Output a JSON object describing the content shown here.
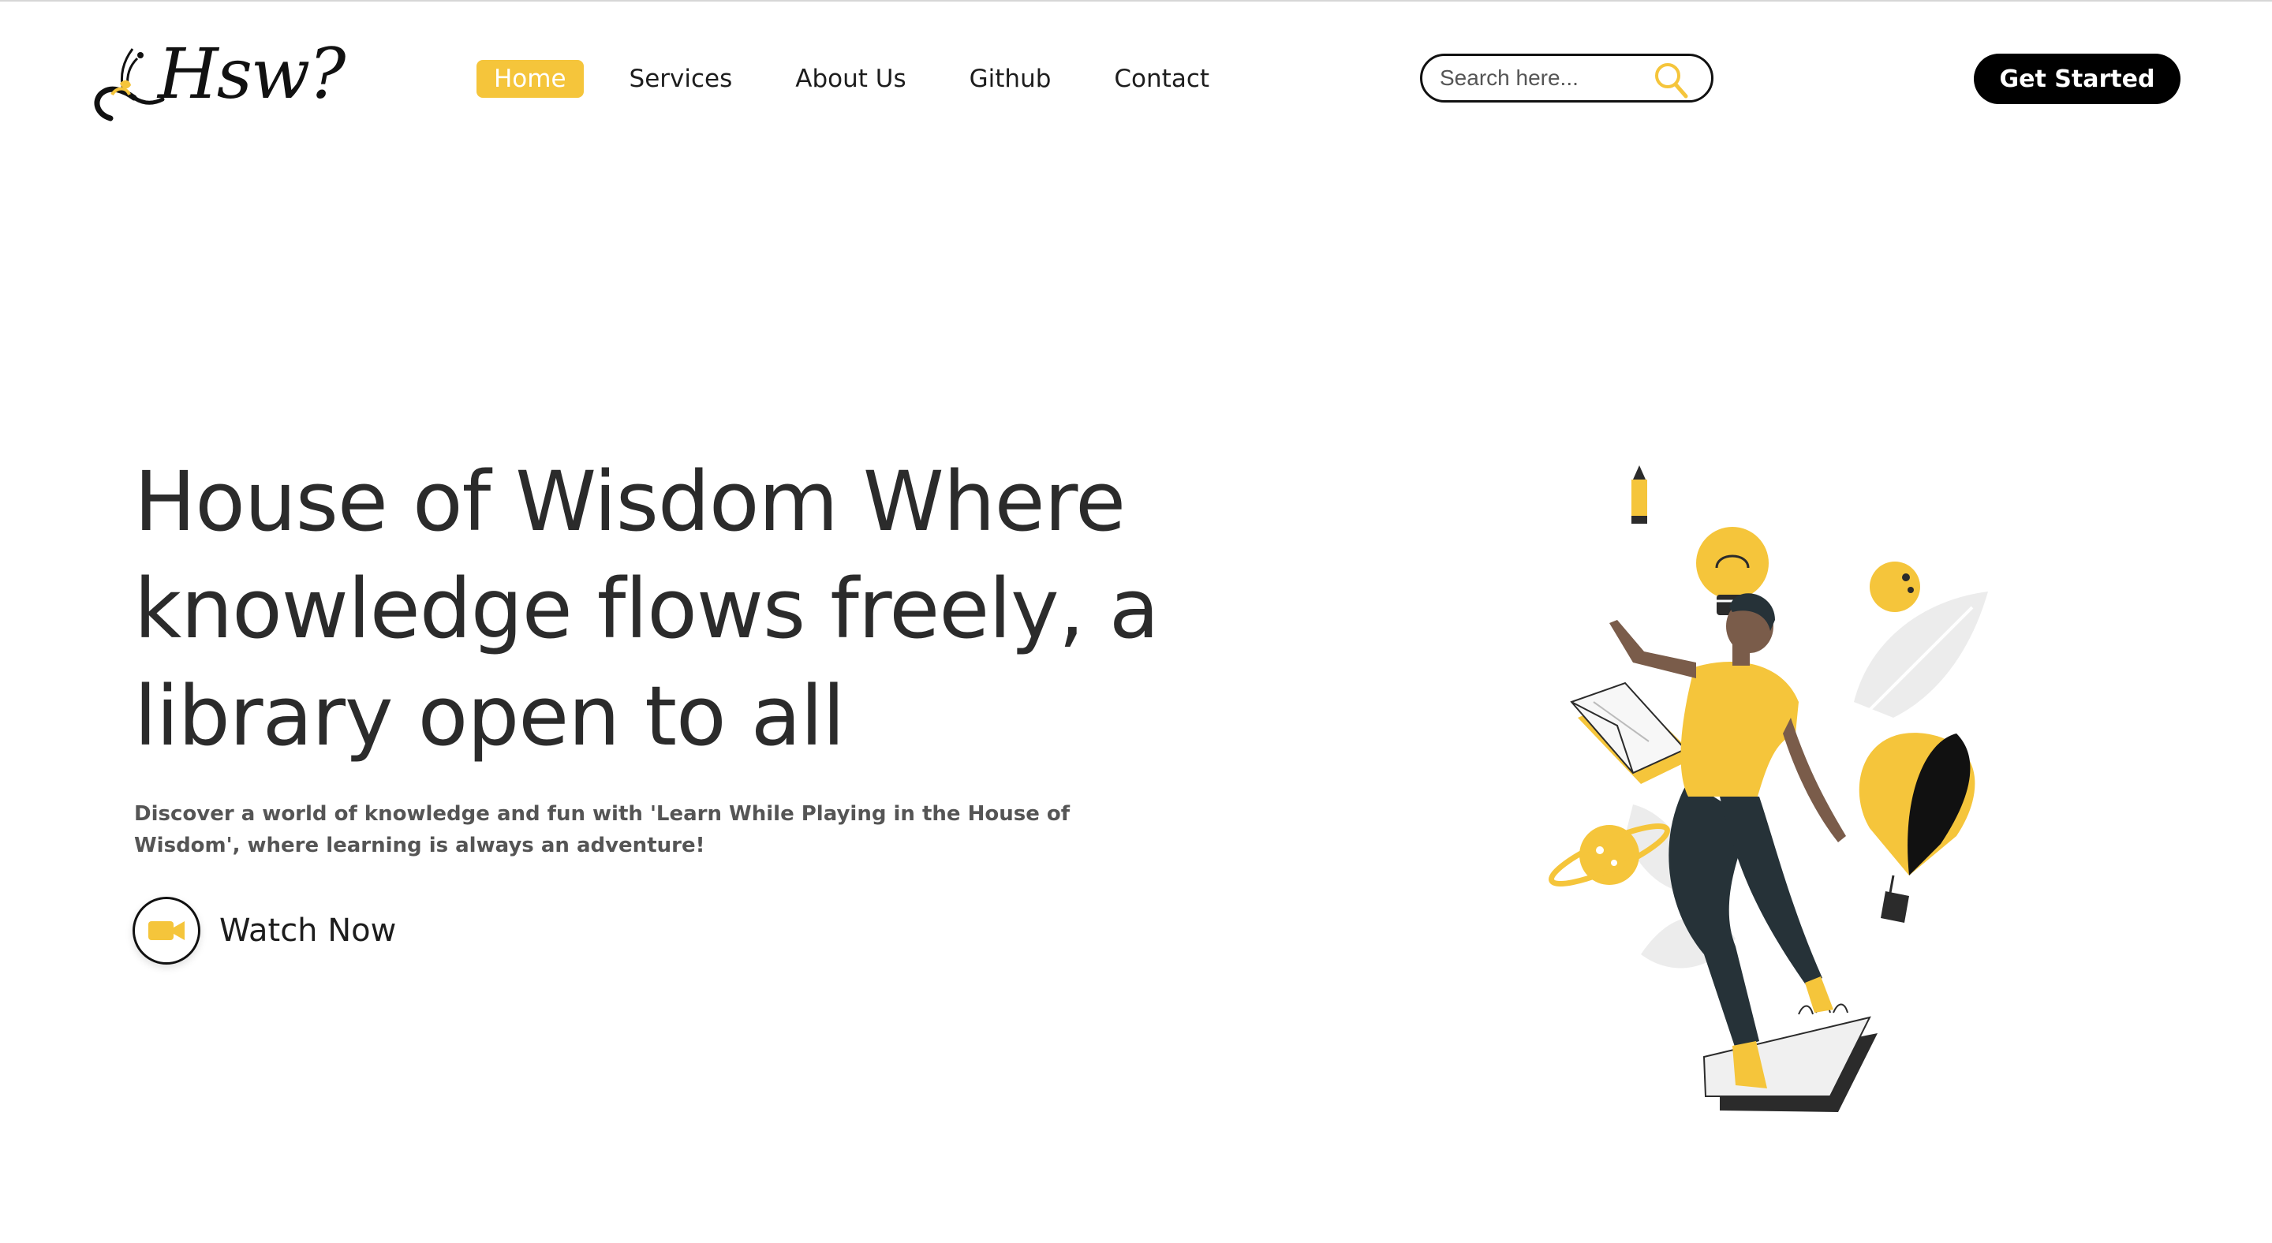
{
  "brand": {
    "logo_text": "Hsw?",
    "accent": "#f5c53b"
  },
  "nav": {
    "items": [
      {
        "label": "Home",
        "active": true
      },
      {
        "label": "Services",
        "active": false
      },
      {
        "label": "About Us",
        "active": false
      },
      {
        "label": "Github",
        "active": false
      },
      {
        "label": "Contact",
        "active": false
      }
    ]
  },
  "search": {
    "placeholder": "Search here...",
    "value": "",
    "icon": "search-icon"
  },
  "header": {
    "cta_label": "Get Started"
  },
  "hero": {
    "title": "House of Wisdom Where knowledge flows freely, a library open to all",
    "subtitle": "Discover a world of knowledge and fun with 'Learn While Playing in the House of Wisdom', where learning is always an adventure!",
    "watch_label": "Watch Now",
    "watch_icon": "video-camera-icon"
  },
  "colors": {
    "primary": "#f5c53b",
    "dark": "#000000",
    "text": "#2b2b2b",
    "muted": "#555555"
  }
}
